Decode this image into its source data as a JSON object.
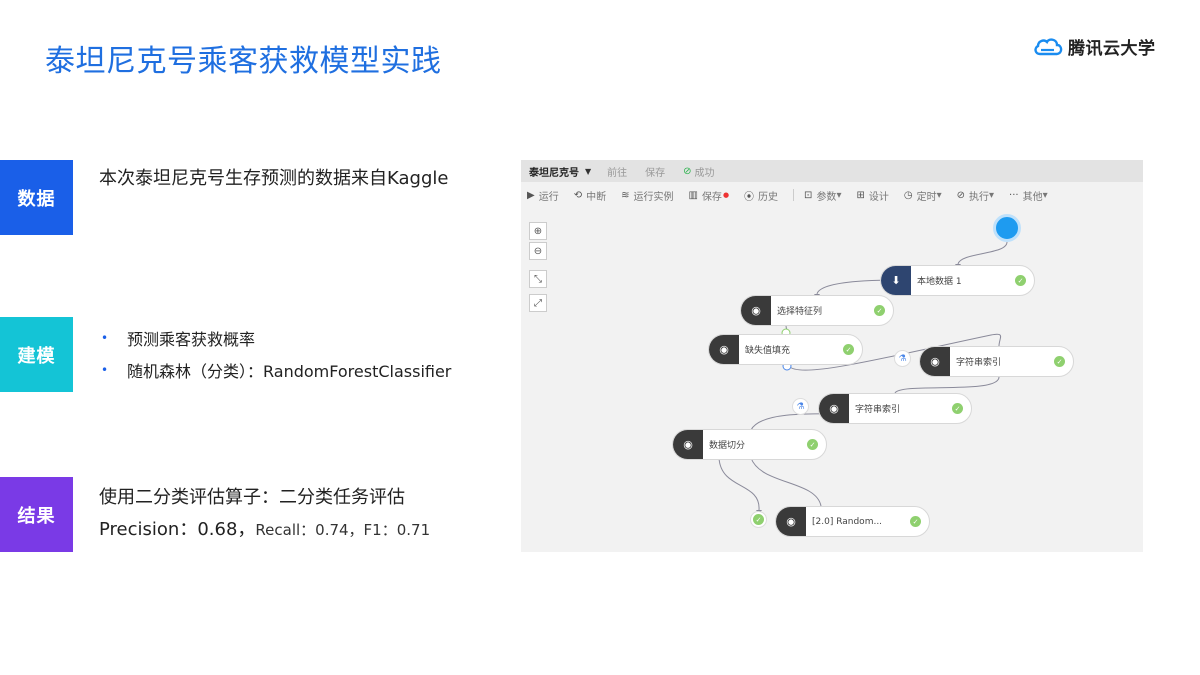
{
  "slide": {
    "title": "泰坦尼克号乘客获救模型实践",
    "logo_text": "腾讯云大学"
  },
  "sections": {
    "data_tag": "数据",
    "data_text": "本次泰坦尼克号生存预测的数据来自Kaggle",
    "model_tag": "建模",
    "model_bullets": [
      "预测乘客获救概率",
      "随机森林（分类）：RandomForestClassifier"
    ],
    "bullet_glyph": "•",
    "result_tag": "结果",
    "result_line1": "使用二分类评估算子：二分类任务评估",
    "result_precision": "Precision：0.68，",
    "result_rest": "Recall：0.74，F1：0.71"
  },
  "screenshot": {
    "project_name": "泰坦尼克号",
    "top_items": [
      "前往",
      "保存"
    ],
    "status": "成功",
    "toolbar": [
      {
        "icon": "▶",
        "label": "运行"
      },
      {
        "icon": "⟲",
        "label": "中断"
      },
      {
        "icon": "≋",
        "label": "运行实例"
      },
      {
        "icon": "▥",
        "label": "保存"
      },
      {
        "icon": "⦿",
        "label": "历史"
      },
      {
        "icon": "⊡",
        "label": "参数"
      },
      {
        "icon": "⊞",
        "label": "设计"
      },
      {
        "icon": "◷",
        "label": "定时"
      },
      {
        "icon": "⊘",
        "label": "执行"
      },
      {
        "icon": "···",
        "label": "其他"
      }
    ],
    "zoom_buttons": [
      "⊕",
      "⊖",
      "⤡",
      "⤢"
    ],
    "nodes": [
      {
        "label": "本地数据 1"
      },
      {
        "label": "选择特征列"
      },
      {
        "label": "缺失值填充"
      },
      {
        "label": "字符串索引"
      },
      {
        "label": "字符串索引"
      },
      {
        "label": "数据切分"
      },
      {
        "label": "[2.0] Random..."
      }
    ],
    "check_glyph": "✓",
    "node_icon_glyph": "◉",
    "upload_icon_glyph": "⬇",
    "mini_icon_glyph": "⚗"
  },
  "colors": {
    "title": "#1f6fe0",
    "tag_data": "#1a5fe8",
    "tag_model": "#14c4d6",
    "tag_result": "#7a3ae6",
    "start_node": "#1e9bf0",
    "success": "#8fd06f"
  }
}
